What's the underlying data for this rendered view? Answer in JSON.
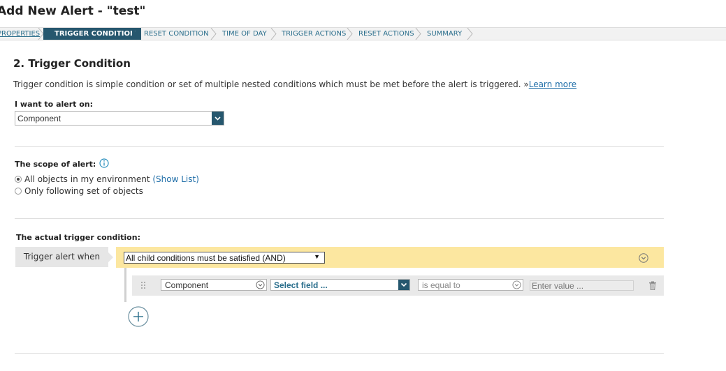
{
  "header": {
    "title": "Add New Alert - \"test\""
  },
  "wizard": {
    "steps": [
      {
        "label": "PROPERTIES",
        "state": "link"
      },
      {
        "label": "TRIGGER CONDITION",
        "state": "active"
      },
      {
        "label": "RESET CONDITION",
        "state": "normal"
      },
      {
        "label": "TIME OF DAY",
        "state": "normal"
      },
      {
        "label": "TRIGGER ACTIONS",
        "state": "normal"
      },
      {
        "label": "RESET ACTIONS",
        "state": "normal"
      },
      {
        "label": "SUMMARY",
        "state": "normal"
      }
    ]
  },
  "section": {
    "title": "2. Trigger Condition",
    "description": "Trigger condition is simple condition or set of multiple nested conditions which must be met before the alert is triggered. »",
    "learn_more": "Learn more"
  },
  "alert_on": {
    "label": "I want to alert on:",
    "value": "Component"
  },
  "scope": {
    "label": "The scope of alert:",
    "options": [
      {
        "label": "All objects in my environment",
        "selected": true,
        "extra": "(Show List)"
      },
      {
        "label": "Only following set of objects",
        "selected": false
      }
    ]
  },
  "trigger": {
    "section_label": "The actual trigger condition:",
    "when_label": "Trigger alert when",
    "group_operator": "All child conditions must be satisfied (AND)",
    "condition": {
      "object": "Component",
      "field": "Select field ...",
      "operator": "is equal to",
      "value_placeholder": "Enter value ..."
    }
  },
  "icons": {
    "info": "info-icon",
    "chevron": "chevron-down-icon",
    "drag": "drag-handle-icon",
    "delete": "trash-icon",
    "add": "add-circle-icon"
  },
  "colors": {
    "accent": "#26576e",
    "link": "#1f6ea8",
    "group_bar": "#fce7a0",
    "condition_row": "#e9e9e9"
  }
}
